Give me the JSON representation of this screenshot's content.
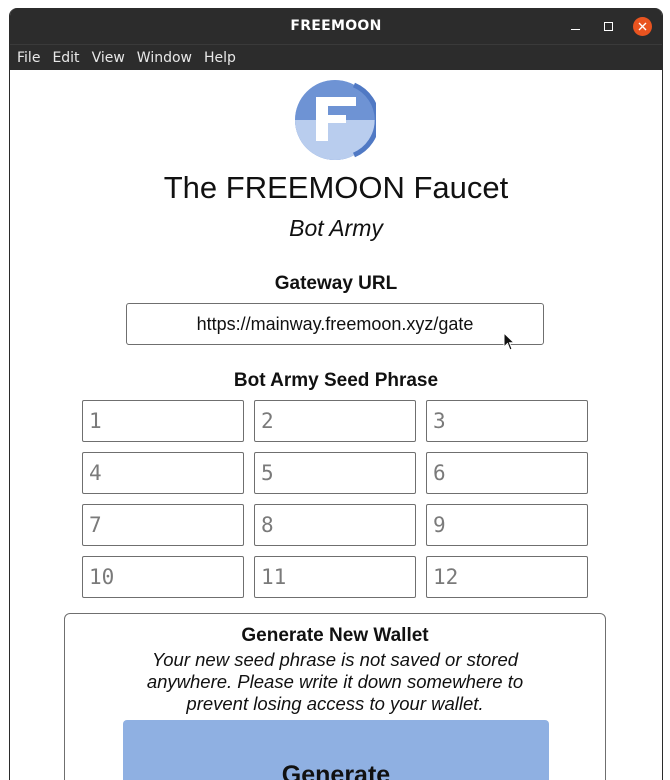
{
  "window": {
    "title": "FREEMOON",
    "close_color": "#e95420"
  },
  "menu": [
    "File",
    "Edit",
    "View",
    "Window",
    "Help"
  ],
  "header": {
    "logo_letter": "F",
    "title": "The FREEMOON Faucet",
    "subtitle": "Bot Army"
  },
  "gateway": {
    "label": "Gateway URL",
    "value": "https://mainway.freemoon.xyz/gate"
  },
  "seed": {
    "label": "Bot Army Seed Phrase",
    "placeholders": [
      "1",
      "2",
      "3",
      "4",
      "5",
      "6",
      "7",
      "8",
      "9",
      "10",
      "11",
      "12"
    ]
  },
  "generate_card": {
    "title": "Generate New Wallet",
    "description": "Your new seed phrase is not saved or stored anywhere. Please write it down somewhere to prevent losing access to your wallet.",
    "button_label": "Generate",
    "button_color": "#8fb0e2"
  }
}
